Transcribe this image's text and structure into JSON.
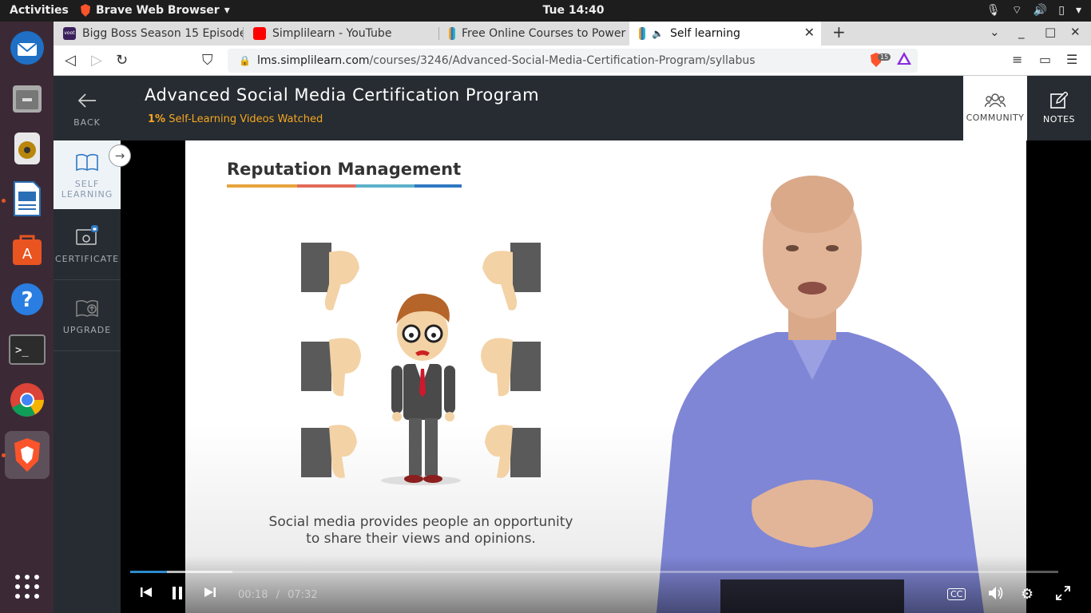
{
  "system": {
    "activities": "Activities",
    "app_menu": "Brave Web Browser",
    "clock": "Tue 14:40"
  },
  "browser": {
    "tabs": [
      {
        "title": "Bigg Boss Season 15 Episode",
        "favicon_color": "#3a1f5d",
        "favicon_text": "voot"
      },
      {
        "title": "Simplilearn - YouTube",
        "favicon_color": "#ff0000"
      },
      {
        "title": "Free Online Courses to Power",
        "favicon_color": "#2f78c2"
      },
      {
        "title": "Self learning",
        "favicon_color": "#2f78c2",
        "active": true
      }
    ],
    "url_host": "lms.simplilearn.com",
    "url_path": "/courses/3246/Advanced-Social-Media-Certification-Program/syllabus",
    "shield_count": "15"
  },
  "sidebar": {
    "back": "BACK",
    "self_learning_1": "SELF",
    "self_learning_2": "LEARNING",
    "certificate": "CERTIFICATE",
    "upgrade": "UPGRADE"
  },
  "course": {
    "title": "Advanced Social Media Certification Program",
    "progress_pct": "1%",
    "progress_label": "Self-Learning Videos Watched",
    "community": "COMMUNITY",
    "notes": "NOTES"
  },
  "video": {
    "slide_heading": "Reputation Management",
    "caption_line1": "Social media provides people an opportunity",
    "caption_line2": "to share their views and opinions.",
    "current_time": "00:18",
    "separator": "/",
    "duration": "07:32",
    "played_fraction": 0.04,
    "buffered_fraction": 0.11,
    "cc": "CC"
  },
  "colors": {
    "accent": "#f5a623",
    "nav_bg": "#262c31",
    "seek": "#2d8ccd"
  }
}
